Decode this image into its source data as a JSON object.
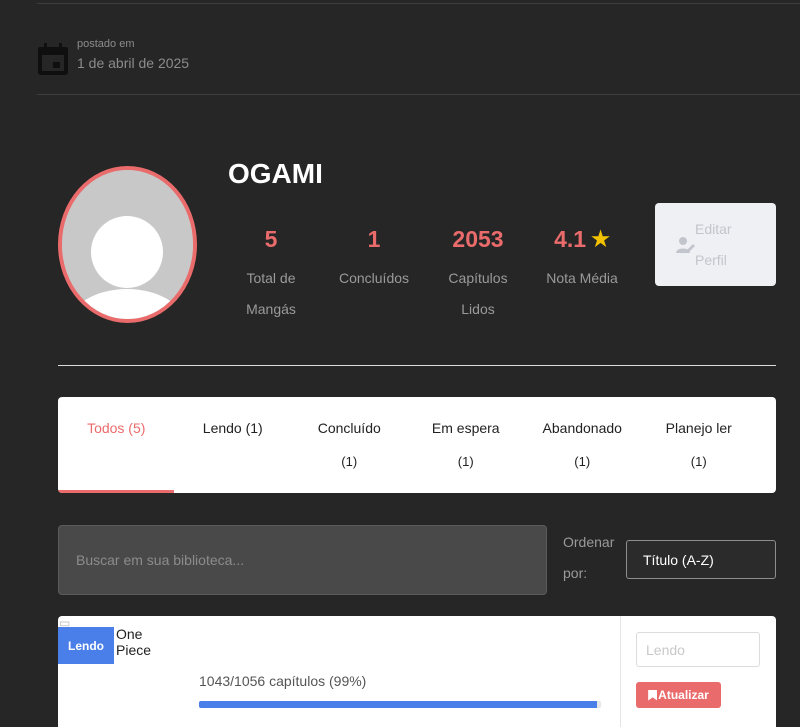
{
  "post": {
    "label": "postado em",
    "date": "1 de abril de 2025",
    "icon": "calendar-icon"
  },
  "profile": {
    "username": "OGAMI",
    "avatar_icon": "user-avatar-icon",
    "stats": [
      {
        "value": "5",
        "label": "Total de Mangás"
      },
      {
        "value": "1",
        "label": "Concluídos"
      },
      {
        "value": "2053",
        "label": "Capítulos Lidos"
      },
      {
        "value": "4.1",
        "label": "Nota Média",
        "icon": "star-icon"
      }
    ],
    "edit_button": {
      "label": "Editar Perfil",
      "icon": "user-edit-icon"
    }
  },
  "tabs": [
    {
      "label": "Todos (5)",
      "active": true
    },
    {
      "label": "Lendo (1)"
    },
    {
      "label": "Concluído",
      "count": "(1)"
    },
    {
      "label": "Em espera",
      "count": "(1)"
    },
    {
      "label": "Abandonado",
      "count": "(1)"
    },
    {
      "label": "Planejo ler",
      "count": "(1)"
    }
  ],
  "search": {
    "placeholder": "Buscar em sua biblioteca...",
    "value": ""
  },
  "sort": {
    "label": "Ordenar por:",
    "selected": "Título (A-Z)"
  },
  "library": [
    {
      "title_alt": "One Piece",
      "status_badge": "Lendo",
      "progress_text": "1043/1056 capítulos (99%)",
      "progress_fraction": 0.99,
      "status_select": "Lendo",
      "update_label": "Atualizar"
    }
  ],
  "colors": {
    "accent": "#ea6b6b",
    "blue": "#4a7fea",
    "star": "#f2c200",
    "background": "#262626"
  }
}
